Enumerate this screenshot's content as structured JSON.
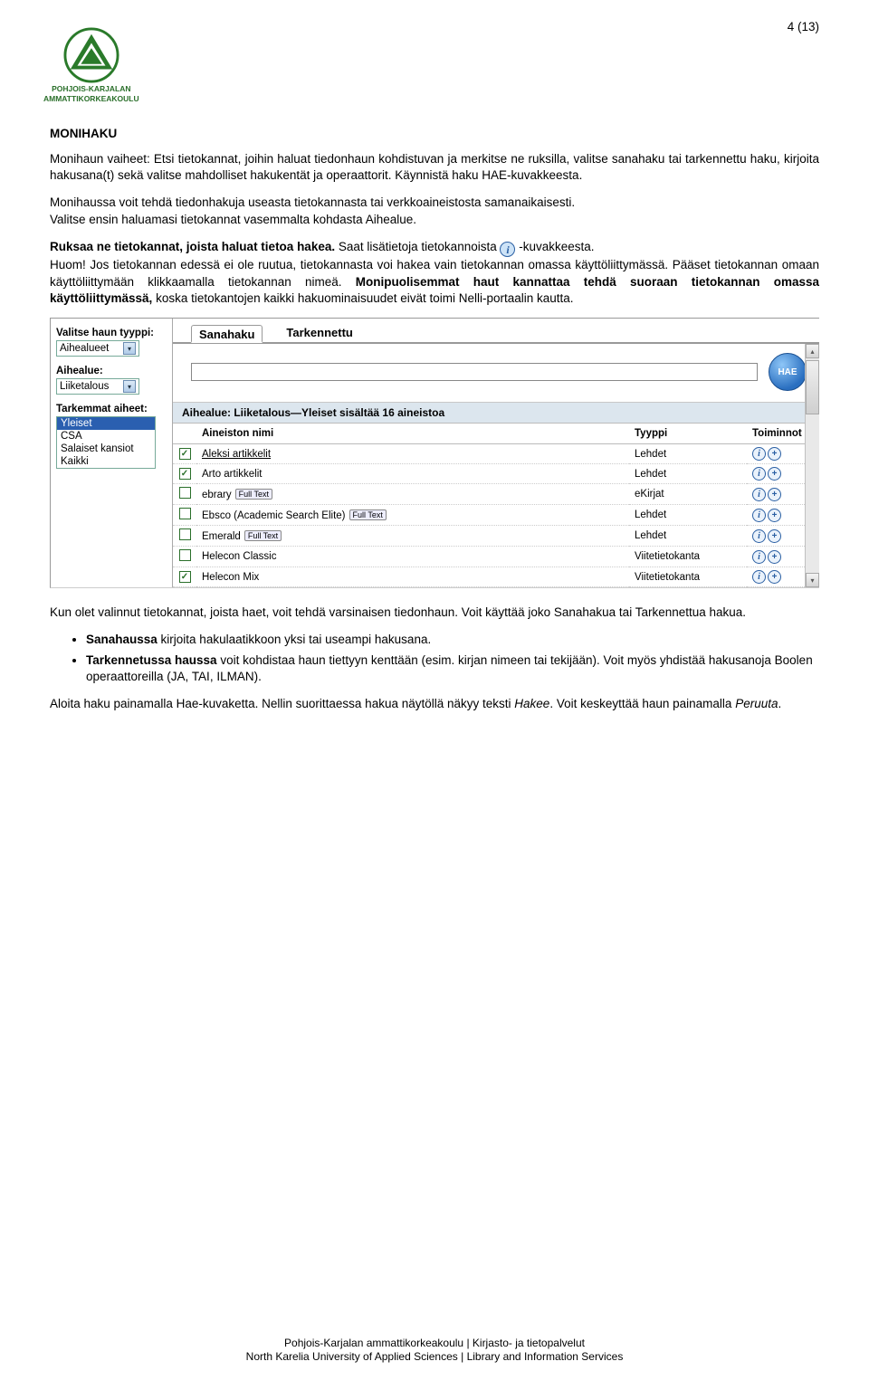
{
  "page_number": "4 (13)",
  "logo": {
    "line1": "POHJOIS-KARJALAN",
    "line2": "AMMATTIKORKEAKOULU"
  },
  "heading": "MONIHAKU",
  "p1": "Monihaun vaiheet: Etsi tietokannat, joihin haluat tiedonhaun kohdistuvan ja merkitse ne ruksilla, valitse sanahaku tai tarkennettu haku, kirjoita hakusana(t) sekä valitse mahdolliset hakukentät ja operaattorit. Käynnistä haku HAE-kuvakkeesta.",
  "p2a": "Monihaussa voit tehdä tiedonhakuja useasta tietokannasta tai verkkoaineistosta samanaikaisesti.",
  "p2b": "Valitse ensin haluamasi tietokannat vasemmalta kohdasta Aihealue.",
  "p3_bold1": "Ruksaa ne tietokannat, joista haluat tietoa hakea.",
  "p3_mid": " Saat lisätietoja tietokannoista ",
  "p3_after": " -kuvakkeesta.",
  "p3_line2a": "Huom! Jos tietokannan edessä ei ole ruutua, tietokannasta voi hakea vain tietokannan omassa käyttöliittymässä. Pääset tietokannan omaan käyttöliittymään klikkaamalla tietokannan nimeä. ",
  "p3_bold2": "Monipuolisemmat haut kannattaa tehdä suoraan tietokannan omassa käyttöliittymässä,",
  "p3_tail": " koska tietokantojen kaikki hakuominaisuudet eivät toimi Nelli-portaalin kautta.",
  "shot": {
    "left": {
      "type_lbl": "Valitse haun tyyppi:",
      "type_val": "Aihealueet",
      "area_lbl": "Aihealue:",
      "area_val": "Liiketalous",
      "detail_lbl": "Tarkemmat aiheet:",
      "opts": [
        "Yleiset",
        "CSA",
        "Salaiset kansiot",
        "Kaikki"
      ]
    },
    "tabs": {
      "a": "Sanahaku",
      "b": "Tarkennettu"
    },
    "hae": "HAE",
    "cat": "Aihealue: Liiketalous—Yleiset sisältää 16 aineistoa",
    "cols": {
      "name": "Aineiston nimi",
      "type": "Tyyppi",
      "actions": "Toiminnot"
    },
    "rows": [
      {
        "chk": true,
        "name": "Aleksi artikkelit",
        "badge": "",
        "type": "Lehdet",
        "ul": true
      },
      {
        "chk": true,
        "name": "Arto artikkelit",
        "badge": "",
        "type": "Lehdet",
        "ul": false
      },
      {
        "chk": false,
        "name": "ebrary",
        "badge": "Full Text",
        "type": "eKirjat",
        "ul": false
      },
      {
        "chk": false,
        "name": "Ebsco (Academic Search Elite)",
        "badge": "Full Text",
        "type": "Lehdet",
        "ul": false
      },
      {
        "chk": false,
        "name": "Emerald",
        "badge": "Full Text",
        "type": "Lehdet",
        "ul": false
      },
      {
        "chk": false,
        "name": "Helecon Classic",
        "badge": "",
        "type": "Viitetietokanta",
        "ul": false
      },
      {
        "chk": true,
        "name": "Helecon Mix",
        "badge": "",
        "type": "Viitetietokanta",
        "ul": false
      }
    ]
  },
  "p4": "Kun olet valinnut tietokannat, joista haet, voit tehdä varsinaisen tiedonhaun. Voit käyttää joko Sanahakua tai Tarkennettua hakua.",
  "b1a": "Sanahaussa",
  "b1b": " kirjoita hakulaatikkoon yksi tai useampi hakusana.",
  "b2a": "Tarkennetussa haussa",
  "b2b": " voit kohdistaa haun tiettyyn kenttään (esim. kirjan nimeen tai tekijään). Voit myös yhdistää hakusanoja Boolen operaattoreilla (JA, TAI, ILMAN).",
  "p5": "Aloita haku painamalla Hae-kuvaketta. Nellin suorittaessa hakua näytöllä näkyy teksti ",
  "p5i1": "Hakee",
  "p5b": ". Voit keskeyttää haun painamalla ",
  "p5i2": "Peruuta",
  "p5c": ".",
  "footer1": "Pohjois-Karjalan ammattikorkeakoulu | Kirjasto- ja tietopalvelut",
  "footer2": "North Karelia University of Applied Sciences | Library and Information Services"
}
